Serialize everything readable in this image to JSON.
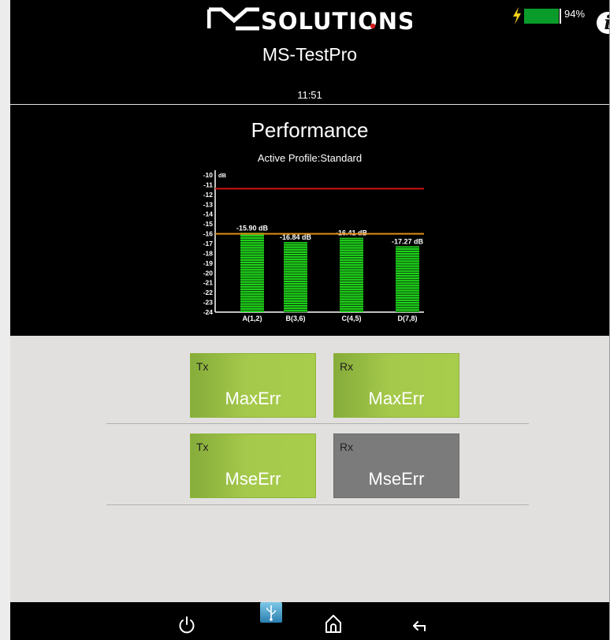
{
  "header": {
    "logo_text": "MSOLUTIONS",
    "app_title": "MS-TestPro",
    "time": "11:51",
    "battery_percent": "94%",
    "battery_level": 0.94,
    "info_icon": "info-icon"
  },
  "performance": {
    "title": "Performance",
    "profile": "Active Profile:Standard"
  },
  "chart_data": {
    "type": "bar",
    "categories": [
      "A(1,2)",
      "B(3,6)",
      "C(4,5)",
      "D(7,8)"
    ],
    "values": [
      -15.9,
      -16.84,
      -16.41,
      -17.27
    ],
    "value_labels": [
      "-15.90 dB",
      "-16.84 dB",
      "-16.41 dB",
      "-17.27 dB"
    ],
    "ylabel": "dB",
    "ylim": [
      -24,
      -10
    ],
    "yticks": [
      "-10",
      "-11",
      "-12",
      "-13",
      "-14",
      "-15",
      "-16",
      "-17",
      "-18",
      "-19",
      "-20",
      "-21",
      "-22",
      "-23",
      "-24"
    ],
    "thresholds": [
      {
        "value": -11.4,
        "color": "#d01010"
      },
      {
        "value": -16.0,
        "color": "#e08c18"
      }
    ],
    "bar_color": "#1fd11a",
    "grid": false
  },
  "tiles": [
    {
      "direction": "Tx",
      "metric": "MaxErr",
      "state": "green"
    },
    {
      "direction": "Rx",
      "metric": "MaxErr",
      "state": "green"
    },
    {
      "direction": "Tx",
      "metric": "MseErr",
      "state": "green"
    },
    {
      "direction": "Rx",
      "metric": "MseErr",
      "state": "gray"
    }
  ],
  "bottom_bar": {
    "icons": [
      "power-icon",
      "usb-icon",
      "home-icon",
      "back-icon"
    ]
  }
}
